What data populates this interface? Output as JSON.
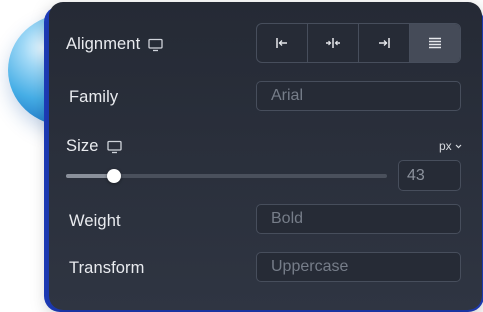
{
  "alignment": {
    "label": "Alignment",
    "options": [
      {
        "name": "align-left",
        "active": false
      },
      {
        "name": "align-center",
        "active": false
      },
      {
        "name": "align-right",
        "active": false
      },
      {
        "name": "align-justify",
        "active": true
      }
    ]
  },
  "family": {
    "label": "Family",
    "placeholder": "Arial"
  },
  "size": {
    "label": "Size",
    "unit": "px",
    "value": "43",
    "slider_fraction": 0.15
  },
  "weight": {
    "label": "Weight",
    "placeholder": "Bold"
  },
  "transform": {
    "label": "Transform",
    "placeholder": "Uppercase"
  },
  "colors": {
    "panel": "#2a2f3a",
    "accent": "#1f3fc4",
    "active_button": "#454b58"
  }
}
